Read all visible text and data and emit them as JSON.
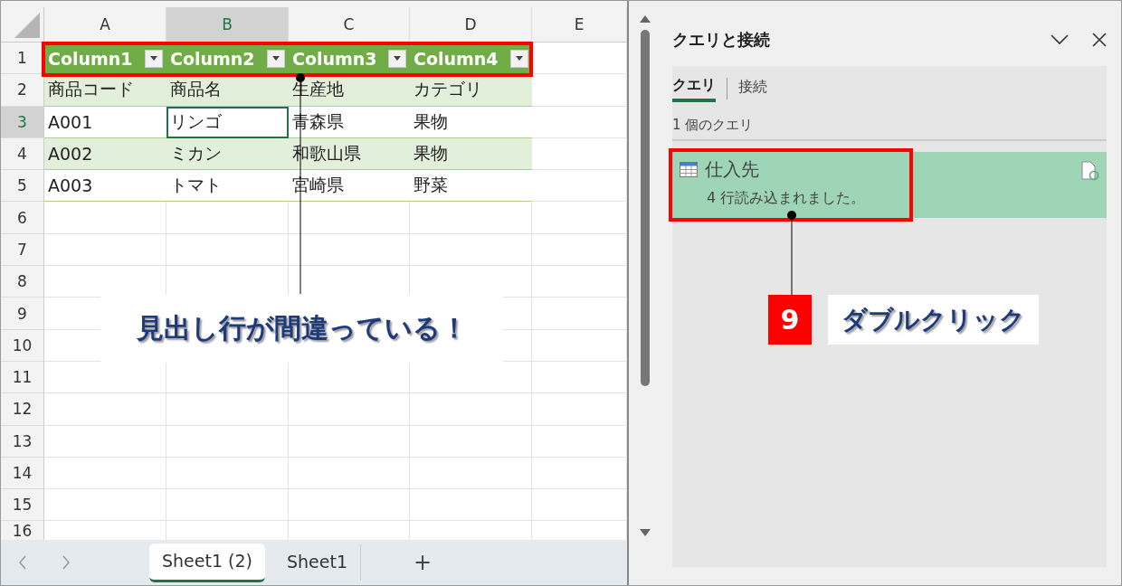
{
  "spreadsheet": {
    "column_headers": [
      {
        "label": "A",
        "selected": false
      },
      {
        "label": "B",
        "selected": true
      },
      {
        "label": "C",
        "selected": false
      },
      {
        "label": "D",
        "selected": false
      },
      {
        "label": "E",
        "selected": false
      }
    ],
    "row_headers": [
      {
        "label": "1",
        "selected": false
      },
      {
        "label": "2",
        "selected": false
      },
      {
        "label": "3",
        "selected": true
      },
      {
        "label": "4",
        "selected": false
      },
      {
        "label": "5",
        "selected": false
      },
      {
        "label": "6",
        "selected": false
      },
      {
        "label": "7",
        "selected": false
      },
      {
        "label": "8",
        "selected": false
      },
      {
        "label": "9",
        "selected": false
      },
      {
        "label": "10",
        "selected": false
      },
      {
        "label": "11",
        "selected": false
      },
      {
        "label": "12",
        "selected": false
      },
      {
        "label": "13",
        "selected": false
      },
      {
        "label": "14",
        "selected": false
      },
      {
        "label": "15",
        "selected": false
      },
      {
        "label": "16",
        "selected": false
      }
    ],
    "header_row": [
      "Column1",
      "Column2",
      "Column3",
      "Column4"
    ],
    "rows": [
      {
        "cells": [
          {
            "text": "商品コード",
            "selected": false
          },
          {
            "text": "商品名",
            "selected": false
          },
          {
            "text": "生産地",
            "selected": false
          },
          {
            "text": "カテゴリ",
            "selected": false
          }
        ]
      },
      {
        "cells": [
          {
            "text": "A001",
            "selected": false
          },
          {
            "text": "リンゴ",
            "selected": true
          },
          {
            "text": "青森県",
            "selected": false
          },
          {
            "text": "果物",
            "selected": false
          }
        ]
      },
      {
        "cells": [
          {
            "text": "A002",
            "selected": false
          },
          {
            "text": "ミカン",
            "selected": false
          },
          {
            "text": "和歌山県",
            "selected": false
          },
          {
            "text": "果物",
            "selected": false
          }
        ]
      },
      {
        "cells": [
          {
            "text": "A003",
            "selected": false
          },
          {
            "text": "トマト",
            "selected": false
          },
          {
            "text": "宮崎県",
            "selected": false
          },
          {
            "text": "野菜",
            "selected": false
          }
        ]
      }
    ],
    "sheet_tabs": [
      {
        "label": "Sheet1 (2)",
        "selected": true
      },
      {
        "label": "Sheet1",
        "selected": false
      }
    ],
    "add_sheet": "+"
  },
  "pane": {
    "title": "クエリと接続",
    "tabs": [
      {
        "label": "クエリ",
        "selected": true
      },
      {
        "label": "接続",
        "selected": false
      }
    ],
    "count": "1 個のクエリ",
    "queries": [
      {
        "name": "仕入先",
        "status": "4 行読み込まれました。",
        "selected": true
      }
    ]
  },
  "annotations": {
    "callout": "見出し行が間違っている！",
    "step_number": "9",
    "step_label": "ダブルクリック"
  }
}
